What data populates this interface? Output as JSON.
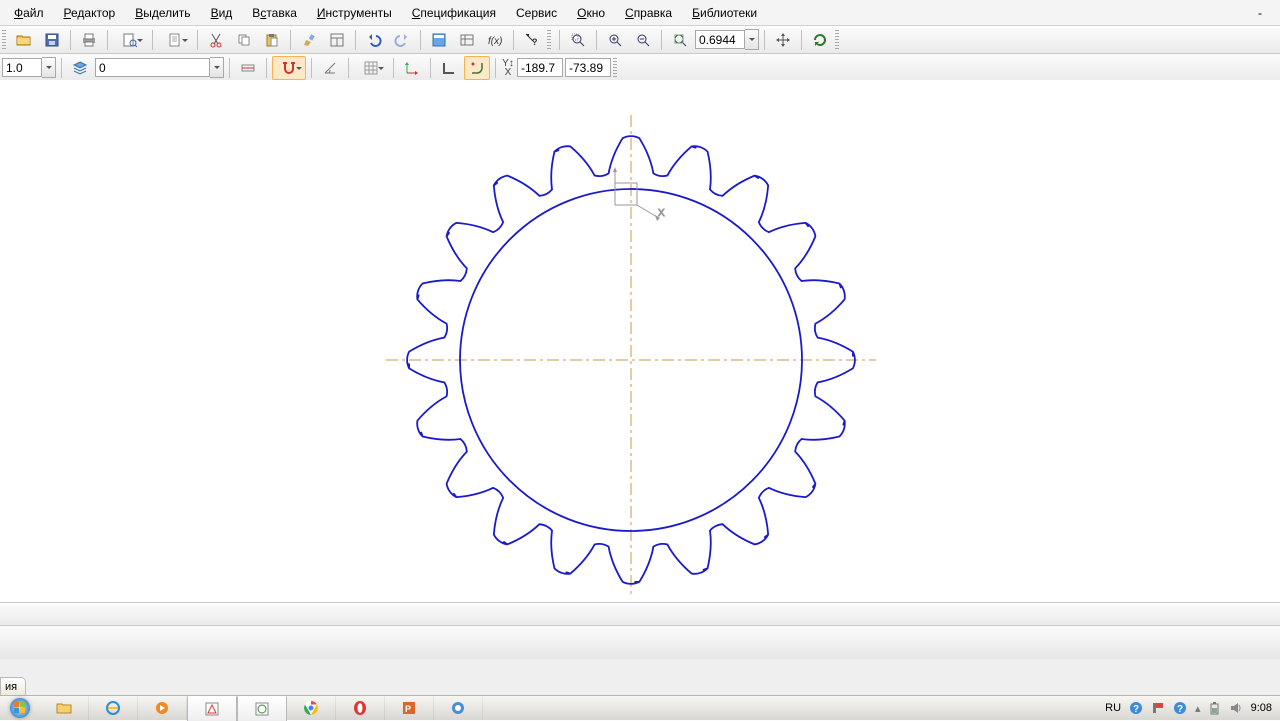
{
  "menu": [
    "Файл",
    "Редактор",
    "Выделить",
    "Вид",
    "Вставка",
    "Инструменты",
    "Спецификация",
    "Сервис",
    "Окно",
    "Справка",
    "Библиотеки"
  ],
  "menu_acc": [
    0,
    0,
    0,
    0,
    1,
    0,
    0,
    -1,
    0,
    0,
    0
  ],
  "toolbar1": {
    "zoom_value": "0.6944",
    "coord_x": "-189.7",
    "coord_y": "-73.89"
  },
  "toolbar2": {
    "line_width": "1.0",
    "layer_value": "0"
  },
  "workspace": {
    "x_label": "X"
  },
  "tab_fragment": "ия",
  "tray": {
    "lang": "RU",
    "time": "9:08"
  }
}
